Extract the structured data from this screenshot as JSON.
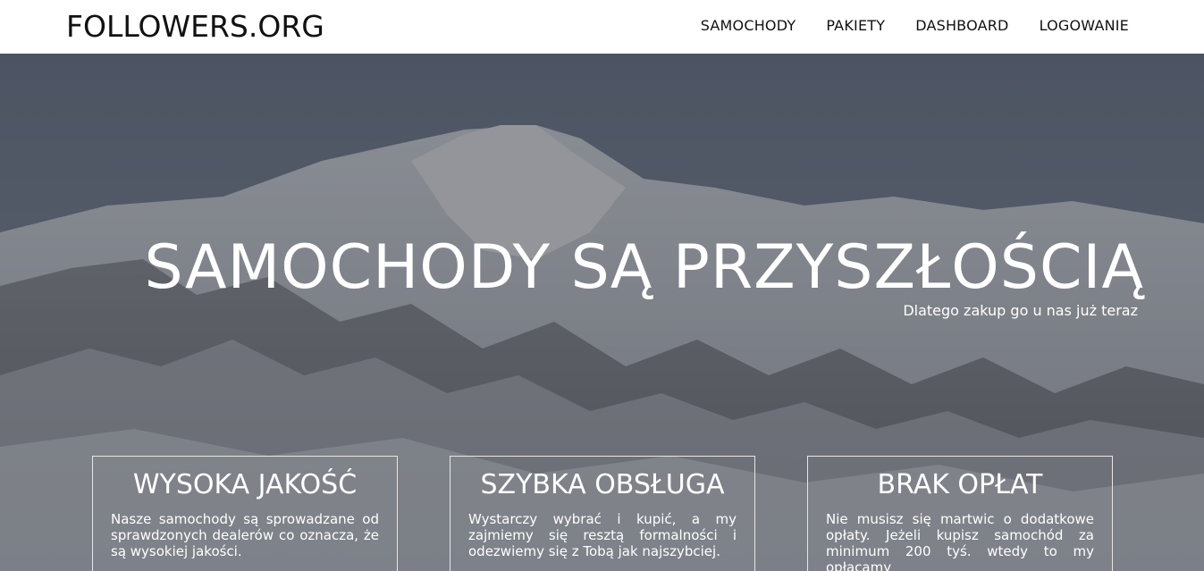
{
  "header": {
    "brand": "FOLLOWERS.ORG",
    "nav": [
      {
        "label": "SAMOCHODY"
      },
      {
        "label": "PAKIETY"
      },
      {
        "label": "DASHBOARD"
      },
      {
        "label": "LOGOWANIE"
      }
    ]
  },
  "hero": {
    "title": "SAMOCHODY SĄ PRZYSZŁOŚCIĄ",
    "subtitle": "Dlatego zakup go u nas już teraz",
    "background": "mountain-photo"
  },
  "features": [
    {
      "title": "WYSOKA JAKOŚĆ",
      "text": "Nasze samochody są sprowadzane od sprawdzonych dealerów co oznacza, że są wysokiej jakości."
    },
    {
      "title": "SZYBKA OBSŁUGA",
      "text": "Wystarczy wybrać i kupić, a my zajmiemy się resztą formalności i odezwiemy się z Tobą jak najszybciej."
    },
    {
      "title": "BRAK OPŁAT",
      "text": "Nie musisz się martwic o dodatkowe opłaty. Jeżeli kupisz samochód za minimum 200 tyś. wtedy to my opłacamy"
    }
  ],
  "colors": {
    "navbar_bg": "#ffffff",
    "text_dark": "#111111",
    "hero_text": "#ffffff",
    "card_border": "#e6e6e6"
  }
}
